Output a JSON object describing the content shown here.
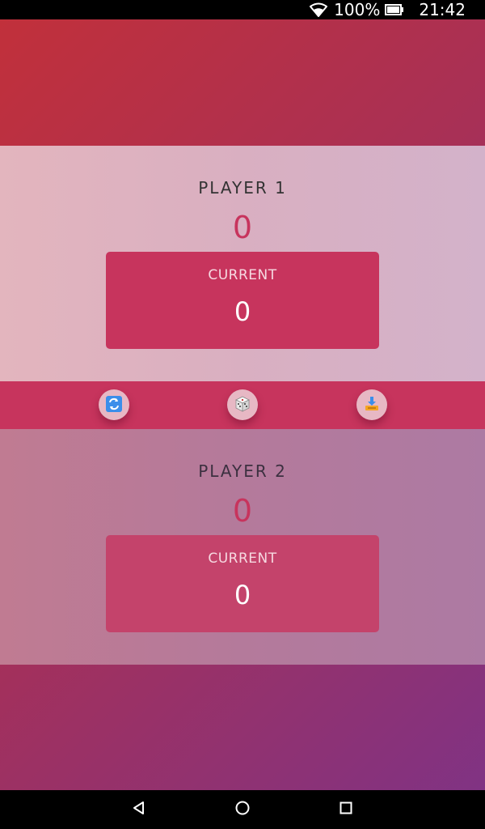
{
  "status_bar": {
    "battery_percent": "100%",
    "time": "21:42",
    "icons": [
      "wifi-icon",
      "battery-icon"
    ]
  },
  "players": [
    {
      "name": "PLAYER 1",
      "score": "0",
      "current_label": "CURRENT",
      "current_value": "0"
    },
    {
      "name": "PLAYER 2",
      "score": "0",
      "current_label": "CURRENT",
      "current_value": "0"
    }
  ],
  "controls": {
    "icons": [
      "new-game-icon",
      "roll-dice-icon",
      "hold-icon"
    ]
  },
  "nav_bar": {
    "icons": [
      "back-icon",
      "home-icon",
      "recent-apps-icon"
    ]
  },
  "colors": {
    "accent": "#c7345d",
    "background_gradient_start": "#c2303a",
    "background_gradient_end": "#7e3386"
  }
}
